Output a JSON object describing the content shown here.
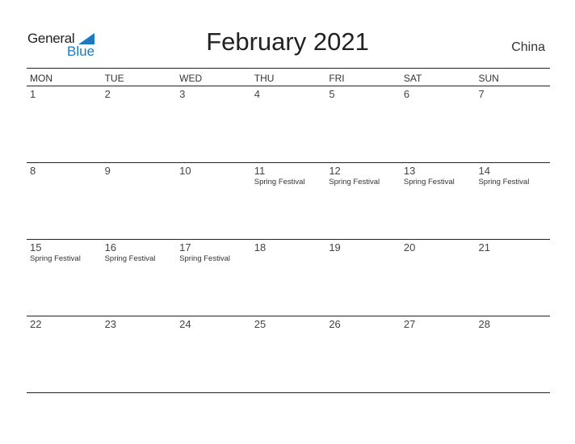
{
  "logo": {
    "line1": "General",
    "line2": "Blue"
  },
  "title": "February 2021",
  "country": "China",
  "weekdays": [
    "MON",
    "TUE",
    "WED",
    "THU",
    "FRI",
    "SAT",
    "SUN"
  ],
  "weeks": [
    [
      {
        "d": "1",
        "e": ""
      },
      {
        "d": "2",
        "e": ""
      },
      {
        "d": "3",
        "e": ""
      },
      {
        "d": "4",
        "e": ""
      },
      {
        "d": "5",
        "e": ""
      },
      {
        "d": "6",
        "e": ""
      },
      {
        "d": "7",
        "e": ""
      }
    ],
    [
      {
        "d": "8",
        "e": ""
      },
      {
        "d": "9",
        "e": ""
      },
      {
        "d": "10",
        "e": ""
      },
      {
        "d": "11",
        "e": "Spring Festival"
      },
      {
        "d": "12",
        "e": "Spring Festival"
      },
      {
        "d": "13",
        "e": "Spring Festival"
      },
      {
        "d": "14",
        "e": "Spring Festival"
      }
    ],
    [
      {
        "d": "15",
        "e": "Spring Festival"
      },
      {
        "d": "16",
        "e": "Spring Festival"
      },
      {
        "d": "17",
        "e": "Spring Festival"
      },
      {
        "d": "18",
        "e": ""
      },
      {
        "d": "19",
        "e": ""
      },
      {
        "d": "20",
        "e": ""
      },
      {
        "d": "21",
        "e": ""
      }
    ],
    [
      {
        "d": "22",
        "e": ""
      },
      {
        "d": "23",
        "e": ""
      },
      {
        "d": "24",
        "e": ""
      },
      {
        "d": "25",
        "e": ""
      },
      {
        "d": "26",
        "e": ""
      },
      {
        "d": "27",
        "e": ""
      },
      {
        "d": "28",
        "e": ""
      }
    ]
  ]
}
